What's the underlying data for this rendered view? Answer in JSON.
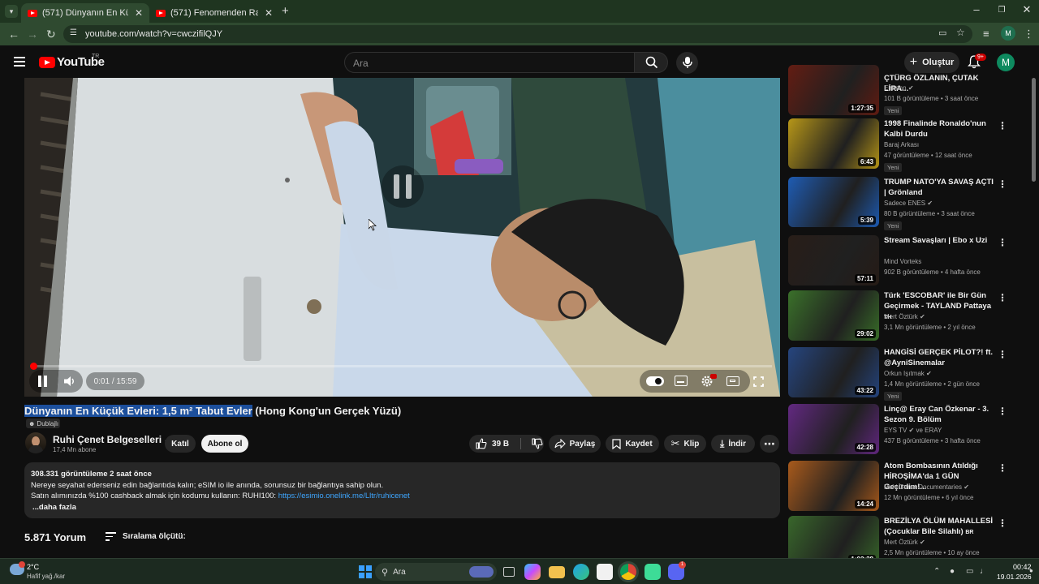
{
  "browser": {
    "tabs": [
      {
        "title": "(571) Dünyanın En Küçük Ev",
        "active": true
      },
      {
        "title": "(571) Fenomenden Rapçiye, Ra",
        "active": false
      }
    ],
    "new_tab": "+",
    "url": "youtube.com/watch?v=cwczifilQJY",
    "profile_initial": "M"
  },
  "yt_header": {
    "logo_text": "YouTube",
    "logo_region": "TR",
    "search_placeholder": "Ara",
    "create_label": "Oluştur",
    "notif_count": "9+",
    "avatar_initial": "M"
  },
  "player": {
    "time": "0:01 / 15:59",
    "progress_fraction": 0.001
  },
  "video": {
    "title_highlighted": "Dünyanın En Küçük Evleri: 1,5 m² Tabut Evler",
    "title_rest": " (Hong Kong'un Gerçek Yüzü)",
    "dub_label": "Dublajlı",
    "channel": "Ruhi Çenet Belgeselleri",
    "subscribers": "17,4 Mn abone",
    "join_label": "Katıl",
    "subscribe_label": "Abone ol",
    "likes": "39 B",
    "share_label": "Paylaş",
    "save_label": "Kaydet",
    "clip_label": "Klip",
    "download_label": "İndir"
  },
  "description": {
    "stats": "308.331 görüntüleme  2 saat önce",
    "line1": "Nereye seyahat ederseniz edin bağlantıda kalın; eSIM io ile anında, sorunsuz bir bağlantıya sahip olun.",
    "line2_prefix": "Satın alımınızda %100 cashback almak için kodumu kullanın: RUHI100: ",
    "line2_link": "https://esimio.onelink.me/Lltr/ruhicenet",
    "more": "...daha fazla"
  },
  "comments": {
    "count": "5.871 Yorum",
    "sort_label": "Sıralama ölçütü:"
  },
  "recommendations": [
    {
      "title": "ÇTÜRG ÖZLANIN, ÇUTAK LİRA...",
      "channel": "Elraenn",
      "verified": true,
      "meta": "101 B görüntüleme • 3 saat önce",
      "duration": "1:27:35",
      "new": "Yeni",
      "thumb": "#6b1d12"
    },
    {
      "title": "1998 Finalinde Ronaldo'nun Kalbi Durdu",
      "channel": "Baraj Arkası",
      "verified": false,
      "meta": "47 görüntüleme • 12 saat önce",
      "duration": "6:43",
      "new": "Yeni",
      "thumb": "#c8a418"
    },
    {
      "title": "TRUMP NATO'YA SAVAŞ AÇTI | Grönland",
      "channel": "Sadece ENES",
      "verified": true,
      "meta": "80 B görüntüleme • 3 saat önce",
      "duration": "5:39",
      "new": "Yeni",
      "thumb": "#1f63c4"
    },
    {
      "title": "Stream Savaşları | Ebo x Uzi",
      "channel": "Mind Vorteks",
      "verified": false,
      "meta": "902 B görüntüleme • 4 hafta önce",
      "duration": "57:11",
      "new": "",
      "thumb": "#2a1e18"
    },
    {
      "title": "Türk 'ESCOBAR' ile Bir Gün Geçirmek - TAYLAND Pattaya",
      "title_suffix": "TH",
      "channel": "Mert Öztürk",
      "verified": true,
      "meta": "3,1 Mn görüntüleme • 2 yıl önce",
      "duration": "29:02",
      "new": "",
      "thumb": "#3e7a2c"
    },
    {
      "title": "HANGİSİ GERÇEK PİLOT?! ft. @AyniSinemalar",
      "channel": "Orkun Işıtmak",
      "verified": true,
      "meta": "1,4 Mn görüntüleme • 2 gün önce",
      "duration": "43:22",
      "new": "Yeni",
      "thumb": "#274a8a"
    },
    {
      "title": "Linç@ Eray Can Özkenar - 3. Sezon 9. Bölüm",
      "channel": "EYS TV",
      "channel_suffix": "ve ERAY",
      "verified": true,
      "meta": "437 B görüntüleme • 3 hafta önce",
      "duration": "42:28",
      "new": "",
      "thumb": "#6a2a8c"
    },
    {
      "title": "Atom Bombasının Atıldığı HİROŞİMA'da 1 GÜN Geçirdim!...",
      "channel": "Ruhi Cenet Documentaries",
      "verified": true,
      "meta": "12 Mn görüntüleme • 6 yıl önce",
      "duration": "14:24",
      "new": "",
      "thumb": "#b8611c"
    },
    {
      "title": "BREZİLYA ÖLÜM MAHALLESİ (Çocuklar Bile Silahlı)",
      "title_suffix": "BR",
      "channel": "Mert Öztürk",
      "verified": true,
      "meta": "2,5 Mn görüntüleme • 10 ay önce",
      "duration": "1:02:38",
      "new": "",
      "thumb": "#3c6f2d"
    }
  ],
  "taskbar": {
    "weather_temp": "2°C",
    "weather_desc": "Hafif yağ./kar",
    "search_label": "Ara",
    "time": "00:42",
    "date": "19.01.2026",
    "discord_badge": "1"
  }
}
